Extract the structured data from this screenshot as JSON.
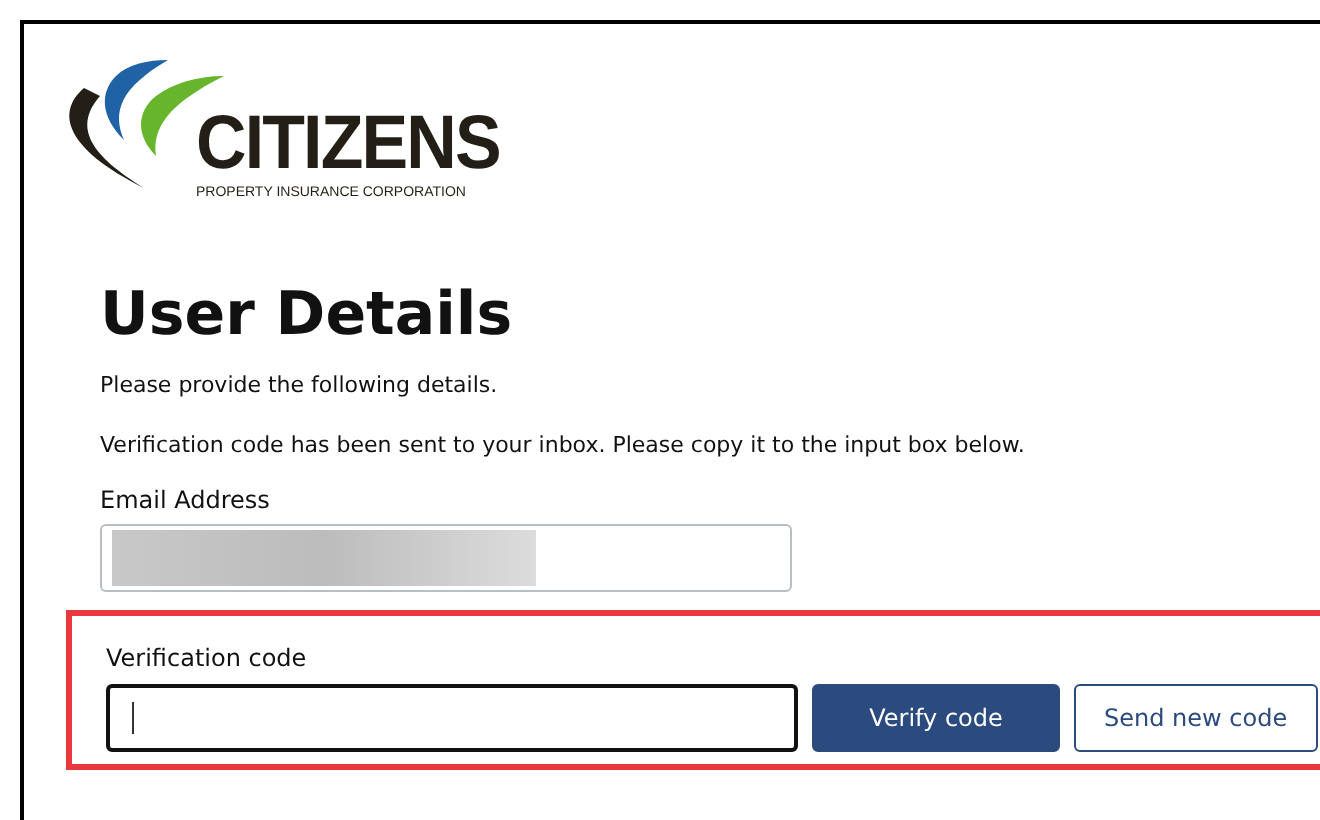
{
  "logo": {
    "name": "CITIZENS",
    "tagline": "PROPERTY INSURANCE CORPORATION"
  },
  "heading": "User Details",
  "intro": "Please provide the following details.",
  "notice": "Verification code has been sent to your inbox. Please copy it to the input box below.",
  "email": {
    "label": "Email Address",
    "redacted": true
  },
  "verification": {
    "label": "Verification code",
    "focused": true,
    "highlighted": true
  },
  "buttons": [
    {
      "label": "Verify code",
      "kind": "primary"
    },
    {
      "label": "Send new code",
      "kind": "secondary"
    }
  ]
}
